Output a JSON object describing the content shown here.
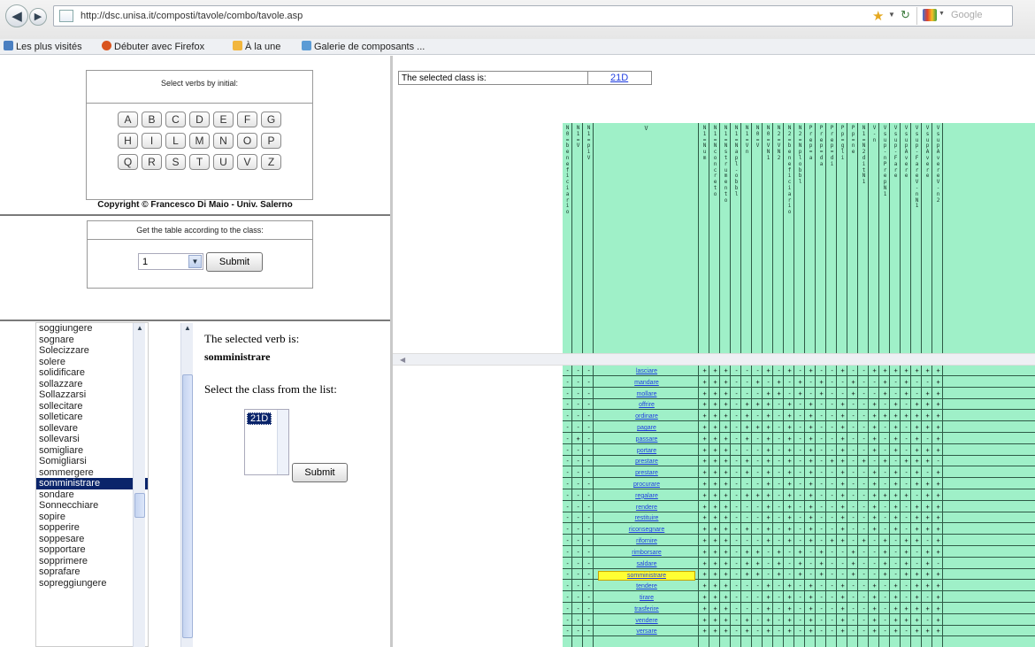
{
  "browser": {
    "url": "http://dsc.unisa.it/composti/tavole/combo/tavole.asp",
    "search_placeholder": "Google",
    "bookmarks": [
      {
        "label": "Les plus visités",
        "color": "#4a7fc1"
      },
      {
        "label": "Débuter avec Firefox",
        "color": "#d9541e"
      },
      {
        "label": "À la une",
        "color": "#f2b63d"
      },
      {
        "label": "Galerie de composants ...",
        "color": "#5b9bd5"
      }
    ]
  },
  "left_panel": {
    "initials_title": "Select verbs by initial:",
    "initials": [
      "A",
      "B",
      "C",
      "D",
      "E",
      "F",
      "G",
      "H",
      "I",
      "L",
      "M",
      "N",
      "O",
      "P",
      "Q",
      "R",
      "S",
      "T",
      "U",
      "V",
      "Z"
    ],
    "copyright": "Copyright © Francesco Di Maio - Univ. Salerno",
    "class_form_title": "Get the table according to the class:",
    "class_select_value": "1",
    "submit_label": "Submit"
  },
  "verb_list": {
    "items": [
      "soggiungere",
      "sognare",
      "Solecizzare",
      "solere",
      "solidificare",
      "sollazzare",
      "Sollazzarsi",
      "sollecitare",
      "solleticare",
      "sollevare",
      "sollevarsi",
      "somigliare",
      "Somigliarsi",
      "sommergere",
      "somministrare",
      "sondare",
      "Sonnecchiare",
      "sopire",
      "sopperire",
      "soppesare",
      "sopportare",
      "sopprimere",
      "soprafare",
      "sopreggiungere"
    ],
    "selected": "somministrare"
  },
  "verb_info": {
    "selected_prefix": "The selected verb is:",
    "selected_verb": "somministrare",
    "select_class_prompt": "Select the class from the list:",
    "class_option": "21D",
    "submit_label": "Submit"
  },
  "table_panel": {
    "selected_class_label": "The selected class is:",
    "selected_class_value": "21D",
    "columns": [
      {
        "h": "N0=benefic iario",
        "w": 11
      },
      {
        "h": "N1=V",
        "w": 11
      },
      {
        "h": "N1=pi V",
        "w": 11
      },
      {
        "h": "V",
        "w": 118
      },
      {
        "h": "N1=Num",
        "w": 11
      },
      {
        "h": "N1=Nconc reto",
        "w": 11
      },
      {
        "h": "N1=Nstru mento",
        "w": 11
      },
      {
        "h": "N1=Napl -obbl",
        "w": 11
      },
      {
        "h": "N1=Vn",
        "w": 11
      },
      {
        "h": "N0=V",
        "w": 11
      },
      {
        "h": "N0=VN1",
        "w": 11
      },
      {
        "h": "N2=VN2",
        "w": 11
      },
      {
        "h": "N2=bene ficiario",
        "w": 11
      },
      {
        "h": "N2=Npl obbl",
        "w": 11
      },
      {
        "h": "Prep=a",
        "w": 11
      },
      {
        "h": "Prep=da",
        "w": 11
      },
      {
        "h": "Prep=di",
        "w": 11
      },
      {
        "h": "Pp=gli",
        "w": 11
      },
      {
        "h": "Pp=ne",
        "w": 11
      },
      {
        "h": "N1=N2 dit N1",
        "w": 11
      },
      {
        "h": "V-n",
        "w": 11
      },
      {
        "h": "Vsup -nPrep N1",
        "w": 11
      },
      {
        "h": "Vsup-Fare",
        "w": 11
      },
      {
        "h": "Vsup Avere",
        "w": 11
      },
      {
        "h": "Vsup-Fare V-nN1",
        "w": 11
      },
      {
        "h": "Vsup Avere",
        "w": 11
      },
      {
        "h": "Vsup Avere V-n2",
        "w": 11
      }
    ],
    "rows": [
      {
        "verb": "lasciare",
        "marks": "---+++---+-+-+--+--+++++++"
      },
      {
        "verb": "mandare",
        "marks": "---+++--+-+-+-+--+--+-+--+"
      },
      {
        "verb": "mollare",
        "marks": "---+++---++-+-+--+--+-+-++"
      },
      {
        "verb": "offrire",
        "marks": "---+++-+++-+-+--+--+-+-+++"
      },
      {
        "verb": "ordinare",
        "marks": "---+++-+-+-+-+--+--+++++++"
      },
      {
        "verb": "pagare",
        "marks": "---+++-+++-+-+--+--+-+-+++"
      },
      {
        "verb": "passare",
        "marks": "-+-+++-+-+-+-+--+--+-+-+-+"
      },
      {
        "verb": "portare",
        "marks": "---+++---+-+-+--+--+-+-+++"
      },
      {
        "verb": "prestare",
        "marks": "---+++-+-+-+-+-++-+-+-+++"
      },
      {
        "verb": "prestare",
        "marks": "---+++-+-+-+-+--+--+-+-+-+"
      },
      {
        "verb": "procurare",
        "marks": "---+++---+-+-+--+--+-+-+++"
      },
      {
        "verb": "regalare",
        "marks": "---+++-+++-+-+--+--++++-++"
      },
      {
        "verb": "rendere",
        "marks": "---+++---+-+-+--+--+-+-+++"
      },
      {
        "verb": "restituire",
        "marks": "---+++---+-+-+--+--+-+-+++"
      },
      {
        "verb": "riconsegnare",
        "marks": "---+++-+-+-+-+--+--+-+-+++"
      },
      {
        "verb": "rifornire",
        "marks": "---+++---+-+-+-++-+-+-++-+"
      },
      {
        "verb": "rimborsare",
        "marks": "---+++-++-+-+-+--+--+-+-+++"
      },
      {
        "verb": "saldare",
        "marks": "---+++-++-+-+-+--+--+-+-+-+"
      },
      {
        "verb": "somministrare",
        "marks": "---+++-++-+-+-+--+--+-+++++"
      },
      {
        "verb": "tendere",
        "marks": "---+++---+-+-+--+--+-+-+++"
      },
      {
        "verb": "tirare",
        "marks": "---+++---+-+-+--+--+-+-+-+"
      },
      {
        "verb": "trasferire",
        "marks": "---+++---+-+-+--+--+-+++++"
      },
      {
        "verb": "vendere",
        "marks": "---+++-+-+-+-+--+--+-+++-+"
      },
      {
        "verb": "versare",
        "marks": "---+++-+-+-+-+--+--+-+-+++"
      }
    ],
    "highlighted_verb": "somministrare"
  }
}
